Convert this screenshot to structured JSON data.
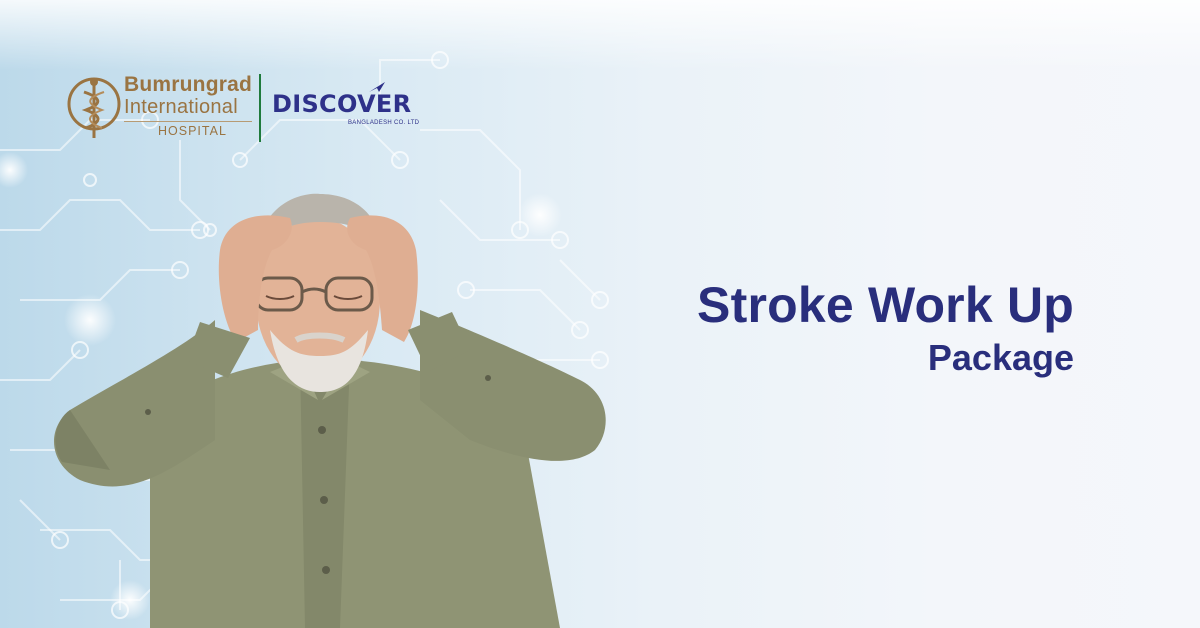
{
  "brand": {
    "hospital_line1": "Bumrungrad",
    "hospital_line2": "International",
    "hospital_line3": "HOSPITAL",
    "partner_name": "DISCOVER",
    "partner_sub": "BANGLADESH CO. LTD"
  },
  "headline": {
    "line1": "Stroke Work Up",
    "line2": "Package"
  },
  "colors": {
    "headline": "#292e7c",
    "hospital_gold": "#9a7442",
    "partner_blue": "#2e3189",
    "divider_green": "#1f7a3c",
    "shirt": "#8f9474"
  }
}
